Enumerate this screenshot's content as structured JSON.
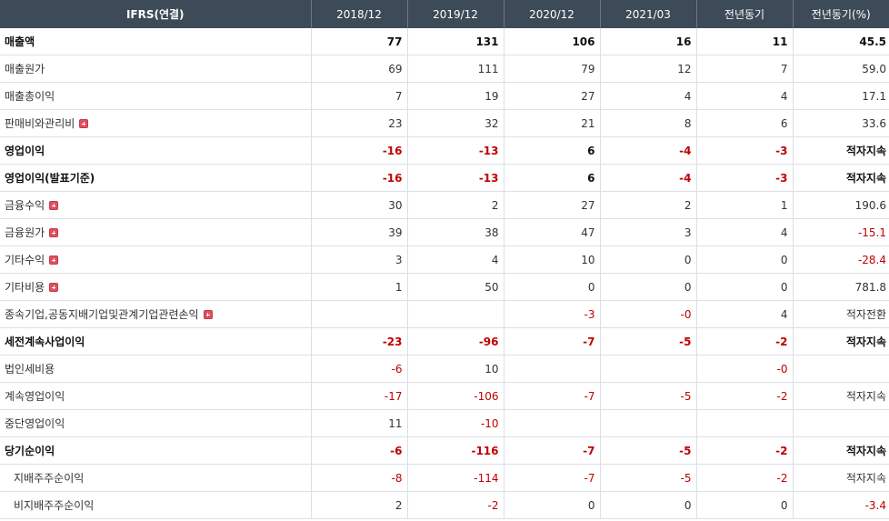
{
  "header": {
    "label_col": "IFRS(연결)",
    "cols": [
      "2018/12",
      "2019/12",
      "2020/12",
      "2021/03",
      "전년동기",
      "전년동기(%)"
    ]
  },
  "rows": [
    {
      "label": "매출액",
      "bold": true,
      "sep": false,
      "sub": false,
      "plus": false,
      "cells": [
        "77",
        "131",
        "106",
        "16",
        "11",
        "45.5"
      ]
    },
    {
      "label": "매출원가",
      "bold": false,
      "sep": false,
      "sub": false,
      "plus": false,
      "cells": [
        "69",
        "111",
        "79",
        "12",
        "7",
        "59.0"
      ]
    },
    {
      "label": "매출총이익",
      "bold": false,
      "sep": false,
      "sub": false,
      "plus": false,
      "cells": [
        "7",
        "19",
        "27",
        "4",
        "4",
        "17.1"
      ]
    },
    {
      "label": "판매비와관리비",
      "bold": false,
      "sep": false,
      "sub": false,
      "plus": true,
      "cells": [
        "23",
        "32",
        "21",
        "8",
        "6",
        "33.6"
      ]
    },
    {
      "label": "영업이익",
      "bold": true,
      "sep": true,
      "sub": false,
      "plus": false,
      "cells": [
        "-16",
        "-13",
        "6",
        "-4",
        "-3",
        "적자지속"
      ]
    },
    {
      "label": "영업이익(발표기준)",
      "bold": true,
      "sep": false,
      "sub": false,
      "plus": false,
      "cells": [
        "-16",
        "-13",
        "6",
        "-4",
        "-3",
        "적자지속"
      ]
    },
    {
      "label": "금융수익",
      "bold": false,
      "sep": false,
      "sub": false,
      "plus": true,
      "cells": [
        "30",
        "2",
        "27",
        "2",
        "1",
        "190.6"
      ]
    },
    {
      "label": "금융원가",
      "bold": false,
      "sep": false,
      "sub": false,
      "plus": true,
      "cells": [
        "39",
        "38",
        "47",
        "3",
        "4",
        "-15.1"
      ]
    },
    {
      "label": "기타수익",
      "bold": false,
      "sep": false,
      "sub": false,
      "plus": true,
      "cells": [
        "3",
        "4",
        "10",
        "0",
        "0",
        "-28.4"
      ]
    },
    {
      "label": "기타비용",
      "bold": false,
      "sep": false,
      "sub": false,
      "plus": true,
      "cells": [
        "1",
        "50",
        "0",
        "0",
        "0",
        "781.8"
      ]
    },
    {
      "label": "종속기업,공동지배기업및관계기업관련손익",
      "bold": false,
      "sep": false,
      "sub": false,
      "plus": true,
      "cells": [
        "",
        "",
        "-3",
        "-0",
        "4",
        "적자전환"
      ]
    },
    {
      "label": "세전계속사업이익",
      "bold": true,
      "sep": false,
      "sub": false,
      "plus": false,
      "cells": [
        "-23",
        "-96",
        "-7",
        "-5",
        "-2",
        "적자지속"
      ]
    },
    {
      "label": "법인세비용",
      "bold": false,
      "sep": false,
      "sub": false,
      "plus": false,
      "cells": [
        "-6",
        "10",
        "",
        "",
        "-0",
        ""
      ]
    },
    {
      "label": "계속영업이익",
      "bold": false,
      "sep": false,
      "sub": false,
      "plus": false,
      "cells": [
        "-17",
        "-106",
        "-7",
        "-5",
        "-2",
        "적자지속"
      ]
    },
    {
      "label": "중단영업이익",
      "bold": false,
      "sep": false,
      "sub": false,
      "plus": false,
      "cells": [
        "11",
        "-10",
        "",
        "",
        "",
        ""
      ]
    },
    {
      "label": "당기순이익",
      "bold": true,
      "sep": false,
      "sub": false,
      "plus": false,
      "cells": [
        "-6",
        "-116",
        "-7",
        "-5",
        "-2",
        "적자지속"
      ]
    },
    {
      "label": "지배주주순이익",
      "bold": false,
      "sep": false,
      "sub": true,
      "plus": false,
      "cells": [
        "-8",
        "-114",
        "-7",
        "-5",
        "-2",
        "적자지속"
      ]
    },
    {
      "label": "비지배주주순이익",
      "bold": false,
      "sep": false,
      "sub": true,
      "plus": false,
      "cells": [
        "2",
        "-2",
        "0",
        "0",
        "0",
        "-3.4"
      ]
    }
  ]
}
